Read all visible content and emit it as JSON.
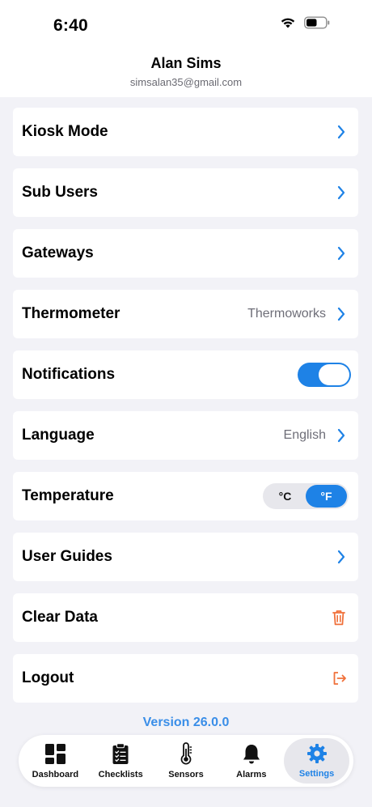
{
  "status": {
    "time": "6:40"
  },
  "profile": {
    "name": "Alan Sims",
    "email": "simsalan35@gmail.com"
  },
  "settings": {
    "kiosk_mode": "Kiosk Mode",
    "sub_users": "Sub Users",
    "gateways": "Gateways",
    "thermometer": {
      "label": "Thermometer",
      "value": "Thermoworks"
    },
    "notifications": {
      "label": "Notifications",
      "enabled": true
    },
    "language": {
      "label": "Language",
      "value": "English"
    },
    "temperature": {
      "label": "Temperature",
      "options": [
        "°C",
        "°F"
      ],
      "selected": "°F"
    },
    "user_guides": "User Guides",
    "clear_data": "Clear Data",
    "logout": "Logout"
  },
  "version": "Version 26.0.0",
  "tabs": [
    {
      "label": "Dashboard",
      "icon": "dashboard-icon"
    },
    {
      "label": "Checklists",
      "icon": "checklist-icon"
    },
    {
      "label": "Sensors",
      "icon": "thermometer-icon"
    },
    {
      "label": "Alarms",
      "icon": "bell-icon"
    },
    {
      "label": "Settings",
      "icon": "gear-icon",
      "active": true
    }
  ],
  "colors": {
    "accent": "#1e82e6",
    "danger": "#f0703a",
    "background": "#f2f2f7"
  }
}
